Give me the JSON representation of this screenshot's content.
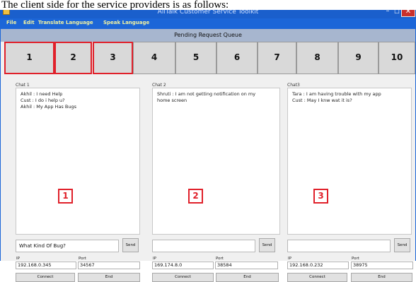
{
  "caption": "The client side for the service providers is as follows:",
  "window": {
    "title": "AllTalk Customer Service Toolkit",
    "min_glyph": "–",
    "max_glyph": "□",
    "close_glyph": "✕"
  },
  "menu": [
    "File",
    "Edit",
    "Translate Language",
    "Speak Language"
  ],
  "queue": {
    "header": "Pending Request Queue",
    "buttons": [
      "1",
      "2",
      "3",
      "4",
      "5",
      "6",
      "7",
      "8",
      "9",
      "10"
    ],
    "highlighted": [
      "1",
      "2",
      "3"
    ]
  },
  "chats": [
    {
      "label": "Chat 1",
      "messages": [
        "Akhil : I need Help",
        "Cust : I do i help u?",
        "Akhil : My App Has Bugs"
      ],
      "marker": "1",
      "input_value": "What Kind Of Bug?",
      "send_label": "Send",
      "ip_label": "IP",
      "ip_value": "192.168.0.345",
      "port_label": "Port",
      "port_value": "34567",
      "connect_label": "Connect",
      "end_label": "End"
    },
    {
      "label": "Chat 2",
      "messages": [
        "Shruti : I am not getting notification on my",
        "home screen"
      ],
      "marker": "2",
      "input_value": "",
      "send_label": "Send",
      "ip_label": "IP",
      "ip_value": "169.174.8.0",
      "port_label": "Port",
      "port_value": "38584",
      "connect_label": "Connect",
      "end_label": "End"
    },
    {
      "label": "Chat3",
      "messages": [
        "Tara : I am having trouble with my app",
        "Cust : May I knw wat it is?"
      ],
      "marker": "3",
      "input_value": "",
      "send_label": "Send",
      "ip_label": "IP",
      "ip_value": "192.168.0.232",
      "port_label": "Port",
      "port_value": "38975",
      "connect_label": "Connect",
      "end_label": "End"
    }
  ],
  "colors": {
    "titlebar": "#1a5fcc",
    "menu_text": "#f4f4a0",
    "highlight_border": "#e0202a",
    "queue_header": "#a7b6cf"
  }
}
